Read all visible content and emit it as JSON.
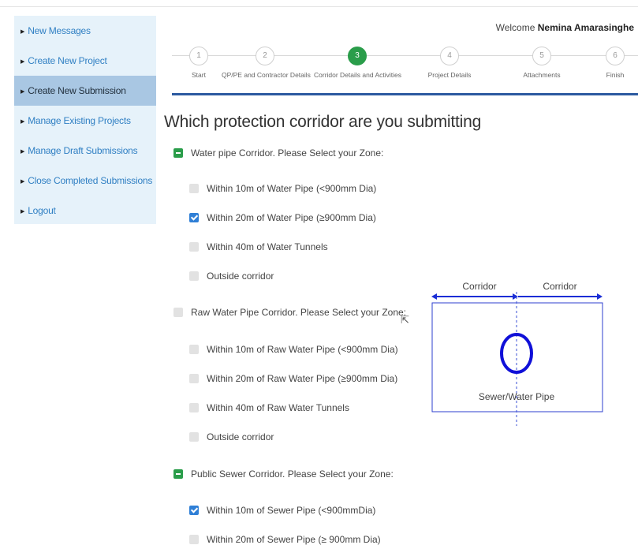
{
  "sidebar": {
    "items": [
      {
        "label": "New Messages"
      },
      {
        "label": "Create New Project"
      },
      {
        "label": "Create New Submission"
      },
      {
        "label": "Manage Existing Projects"
      },
      {
        "label": "Manage Draft Submissions"
      },
      {
        "label": "Close Completed Submissions"
      },
      {
        "label": "Logout"
      }
    ],
    "active_index": 2
  },
  "header": {
    "welcome_prefix": "Welcome",
    "user_name": "Nemina Amarasinghe"
  },
  "stepper": {
    "active_index": 2,
    "steps": [
      {
        "number": "1",
        "label": "Start"
      },
      {
        "number": "2",
        "label": "QP/PE and Contractor Details"
      },
      {
        "number": "3",
        "label": "Corridor Details and Activities"
      },
      {
        "number": "4",
        "label": "Project Details"
      },
      {
        "number": "5",
        "label": "Attachments"
      },
      {
        "number": "6",
        "label": "Finish"
      }
    ]
  },
  "main": {
    "heading": "Which protection corridor are you submitting",
    "groups": [
      {
        "label": "Water pipe Corridor. Please Select your Zone:",
        "state": "indeterminate",
        "options": [
          {
            "label": "Within 10m of Water Pipe (<900mm Dia)",
            "checked": false
          },
          {
            "label": "Within 20m of Water Pipe (≥900mm Dia)",
            "checked": true
          },
          {
            "label": "Within 40m of Water Tunnels",
            "checked": false
          },
          {
            "label": "Outside corridor",
            "checked": false
          }
        ]
      },
      {
        "label": "Raw Water Pipe Corridor. Please Select your Zone:",
        "state": "unchecked",
        "options": [
          {
            "label": "Within 10m of Raw Water Pipe (<900mm Dia)",
            "checked": false
          },
          {
            "label": "Within 20m of Raw Water Pipe (≥900mm Dia)",
            "checked": false
          },
          {
            "label": "Within 40m of Raw Water Tunnels",
            "checked": false
          },
          {
            "label": "Outside corridor",
            "checked": false
          }
        ]
      },
      {
        "label": "Public Sewer Corridor. Please Select your Zone:",
        "state": "indeterminate",
        "options": [
          {
            "label": "Within 10m of Sewer Pipe (<900mmDia)",
            "checked": true
          },
          {
            "label": "Within 20m of Sewer Pipe (≥ 900mm Dia)",
            "checked": false
          }
        ]
      }
    ]
  },
  "diagram": {
    "left_label": "Corridor",
    "right_label": "Corridor",
    "pipe_label": "Sewer/Water Pipe"
  },
  "colors": {
    "accent_blue": "#2c5aa0",
    "active_green": "#2a9d4a",
    "checkbox_blue": "#2f7fd6",
    "sidebar_bg": "#e6f2fa"
  }
}
